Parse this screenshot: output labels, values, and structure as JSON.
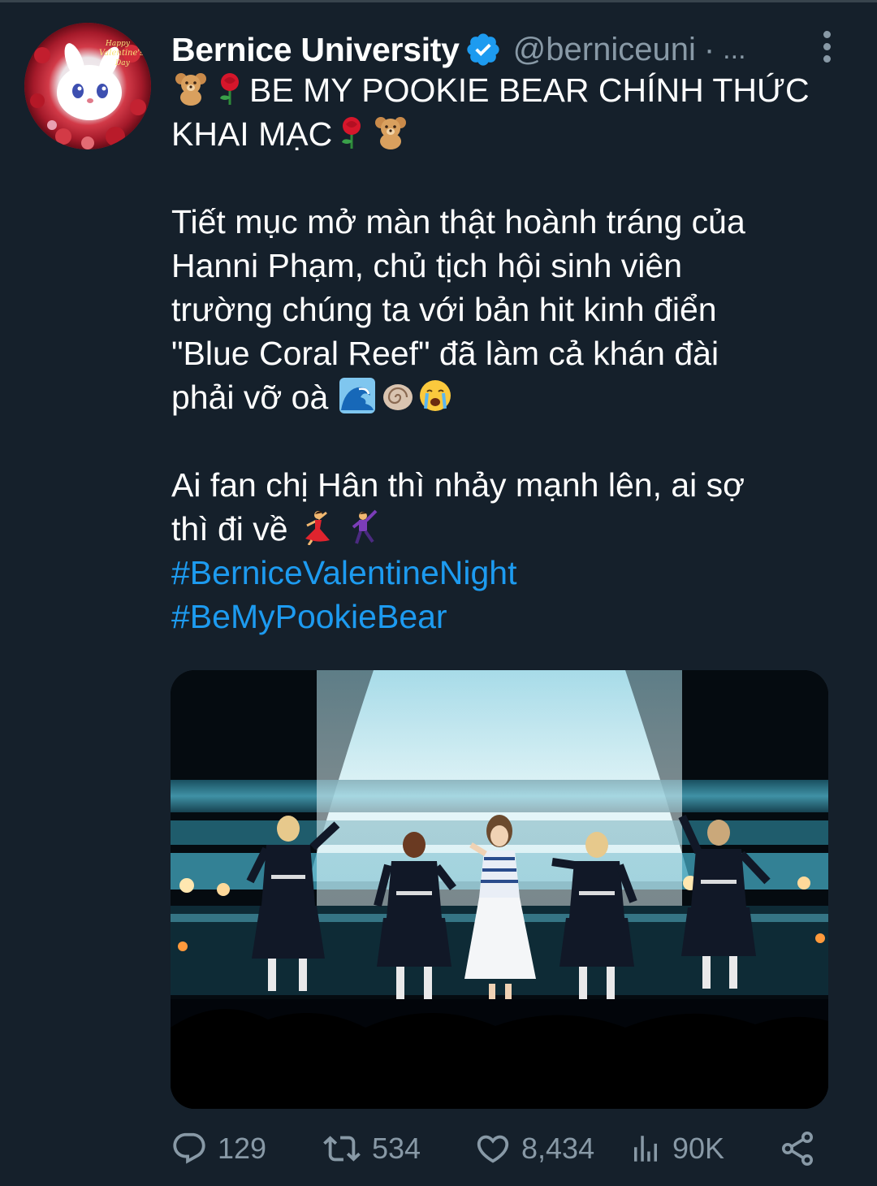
{
  "tweet": {
    "display_name": "Bernice University",
    "handle": "@berniceuni",
    "separator": "·",
    "ellipsis": "...",
    "avatar_text": [
      "Happy",
      "Valentine's",
      "Day"
    ],
    "lines": {
      "l1_text": "BE MY POOKIE BEAR CHÍNH THỨC",
      "l2_text": "KHAI MẠC",
      "p2_1": "Tiết mục mở màn thật hoành tráng của",
      "p2_2": "Hanni Phạm, chủ tịch hội sinh viên",
      "p2_3": "trường chúng ta với bản hit kinh điển",
      "p2_4": "\"Blue Coral Reef\" đã làm cả khán đài",
      "p2_5": "phải vỡ oà",
      "p3_1": "Ai fan chị Hân thì nhảy mạnh lên, ai sợ",
      "p3_2": "thì đi về"
    },
    "emoji": {
      "teddy": "teddy-bear-emoji",
      "rose": "rose-emoji",
      "wave": "water-wave-emoji",
      "shell": "spiral-shell-emoji",
      "crying": "crying-face-emoji",
      "dancer": "woman-dancing-emoji",
      "man_dancer": "man-dancing-emoji"
    },
    "hashtags": [
      "#BerniceValentineNight",
      "#BeMyPookieBear"
    ]
  },
  "actions": {
    "replies": "129",
    "retweets": "534",
    "likes": "8,434",
    "views": "90K"
  },
  "colors": {
    "background": "#15202b",
    "text": "#ffffff",
    "muted": "#8899a6",
    "link": "#1d9bf0",
    "verified": "#1d9bf0"
  }
}
